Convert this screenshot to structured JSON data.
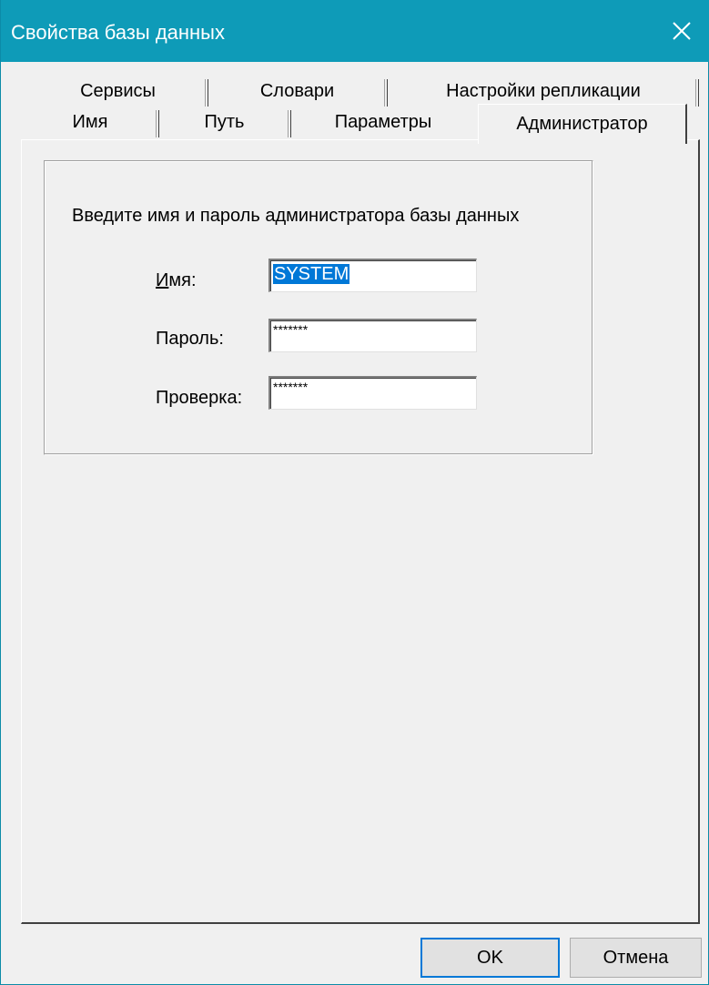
{
  "window": {
    "title": "Свойства базы данных",
    "titlebar_color": "#0e9bb8"
  },
  "tabs": {
    "top_row": [
      {
        "label": "Сервисы"
      },
      {
        "label": "Словари"
      },
      {
        "label": "Настройки репликации"
      }
    ],
    "bottom_row": [
      {
        "label": "Имя"
      },
      {
        "label": "Путь"
      },
      {
        "label": "Параметры"
      },
      {
        "label": "Администратор",
        "active": true
      }
    ]
  },
  "admin_page": {
    "intro": "Введите имя и пароль администратора базы данных",
    "name_label": "Имя:",
    "name_value": "SYSTEM",
    "password_label": "Пароль:",
    "password_value": "*******",
    "confirm_label": "Проверка:",
    "confirm_value": "*******"
  },
  "buttons": {
    "ok": "OK",
    "cancel": "Отмена"
  },
  "icons": {
    "close": "close-icon"
  }
}
